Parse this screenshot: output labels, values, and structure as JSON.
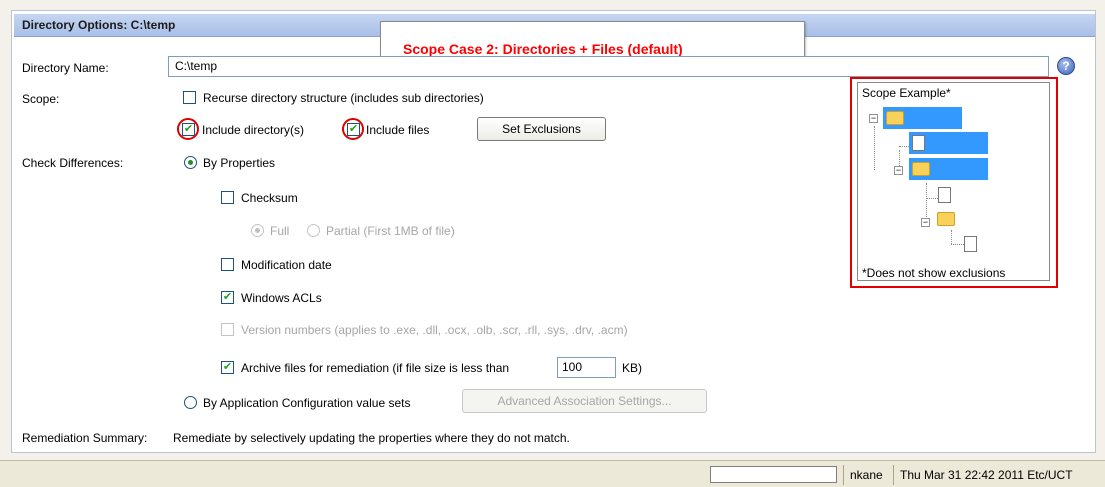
{
  "header": {
    "title": "Directory Options: C:\\temp"
  },
  "callout": {
    "text": "Scope Case 2: Directories + Files (default)"
  },
  "directory_name": {
    "label": "Directory Name:",
    "value": "C:\\temp",
    "help_icon": "help-icon"
  },
  "scope": {
    "label": "Scope:",
    "recurse": {
      "label": "Recurse directory structure (includes sub directories)",
      "checked": false
    },
    "include_dirs": {
      "label": "Include directory(s)",
      "checked": true
    },
    "include_files": {
      "label": "Include files",
      "checked": true
    },
    "set_exclusions_button": "Set Exclusions"
  },
  "check_differences": {
    "label": "Check Differences:",
    "by_properties": {
      "label": "By Properties",
      "selected": true
    },
    "checksum": {
      "label": "Checksum",
      "checked": false
    },
    "checksum_full": {
      "label": "Full",
      "selected": true,
      "enabled": false
    },
    "checksum_partial": {
      "label": "Partial (First 1MB of file)",
      "selected": false,
      "enabled": false
    },
    "modification_date": {
      "label": "Modification date",
      "checked": false
    },
    "windows_acls": {
      "label": "Windows ACLs",
      "checked": true
    },
    "version_numbers": {
      "label": "Version numbers (applies to .exe, .dll, .ocx, .olb, .scr, .rll, .sys, .drv, .acm)",
      "checked": false,
      "enabled": false
    },
    "archive": {
      "label": "Archive files for remediation (if file size is less than",
      "checked": true,
      "size_value": "100",
      "unit": "KB)"
    },
    "by_app_config": {
      "label": "By Application Configuration value sets",
      "selected": false
    },
    "advanced_button": "Advanced Association Settings..."
  },
  "remediation": {
    "label": "Remediation Summary:",
    "text": "Remediate by selectively updating the properties where they do not match."
  },
  "scope_example": {
    "title": "Scope Example*",
    "note": "*Does not show exclusions"
  },
  "statusbar": {
    "user": "nkane",
    "datetime": "Thu Mar 31 22:42 2011 Etc/UCT"
  },
  "colors": {
    "header_bg": "#b4c8ec",
    "callout_text": "#ff0000",
    "highlight_ring": "#e00000",
    "tree_selection": "#3399ff",
    "check_mark": "#21a121"
  }
}
